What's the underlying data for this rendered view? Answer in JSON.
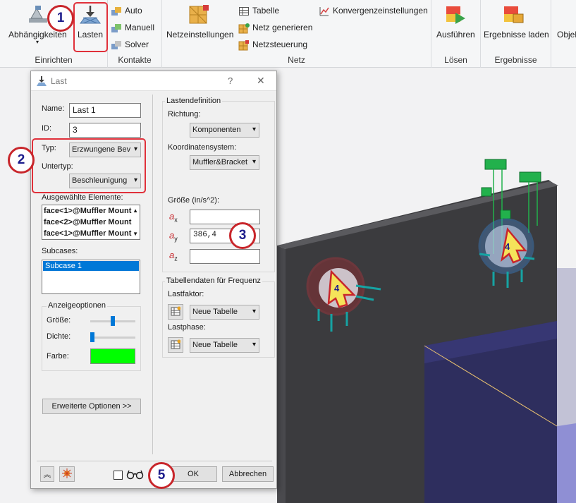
{
  "ribbon": {
    "einrichten": {
      "label": "Einrichten",
      "abh": "Abhängigkeiten",
      "lasten": "Lasten"
    },
    "kontakte": {
      "label": "Kontakte",
      "auto": "Auto",
      "manuell": "Manuell",
      "solver": "Solver"
    },
    "netz": {
      "label": "Netz",
      "netzeinstellungen": "Netzeinstellungen",
      "tabelle": "Tabelle",
      "netz_generieren": "Netz generieren",
      "netzsteuerung": "Netzsteuerung",
      "konvergenz": "Konvergenzeinstellungen"
    },
    "loesen": {
      "label": "Lösen",
      "ausfuehren": "Ausführen"
    },
    "ergebnisse": {
      "label": "Ergebnisse",
      "laden": "Ergebnisse laden"
    },
    "more": "Objel"
  },
  "dialog": {
    "title": "Last",
    "help": "?",
    "close": "✕",
    "name_label": "Name:",
    "name_value": "Last 1",
    "id_label": "ID:",
    "id_value": "3",
    "typ_label": "Typ:",
    "typ_value": "Erzwungene Bev",
    "untertyp_label": "Untertyp:",
    "untertyp_value": "Beschleunigung",
    "elements_label": "Ausgewählte Elemente:",
    "elements": [
      "face<1>@Muffler Mount",
      "face<2>@Muffler Mount",
      "face<1>@Muffler Mount"
    ],
    "subcases_label": "Subcases:",
    "subcases": [
      "Subcase 1"
    ],
    "anzeige_label": "Anzeigeoptionen",
    "groesse_label": "Größe:",
    "dichte_label": "Dichte:",
    "farbe_label": "Farbe:",
    "farbe_color": "#00ff00",
    "groesse_level": 0.5,
    "dichte_level": 0.0,
    "erweitert_btn": "Erweiterte Optionen >>",
    "lastdef_label": "Lastendefinition",
    "richtung_label": "Richtung:",
    "richtung_value": "Komponenten",
    "koord_label": "Koordinatensystem:",
    "koord_value": "Muffler&Bracket",
    "groesse_unit": "Größe (in/s^2):",
    "ax_label": "x",
    "ay_label": "y",
    "az_label": "z",
    "ax_value": "",
    "ay_value": "386,4",
    "az_value": "",
    "tabellen_label": "Tabellendaten für Frequenz",
    "lastfaktor_label": "Lastfaktor:",
    "lastfaktor_value": "Neue Tabelle",
    "lastphase_label": "Lastphase:",
    "lastphase_value": "Neue Tabelle",
    "ok": "OK",
    "abbrechen": "Abbrechen"
  },
  "callouts": [
    "1",
    "2",
    "3",
    "5"
  ],
  "markers": [
    "4",
    "4"
  ],
  "colors": {
    "callout_border": "#c8262b",
    "callout_text": "#1d1d8c",
    "highlight": "#e0303a",
    "constraint": "#22b14c"
  }
}
